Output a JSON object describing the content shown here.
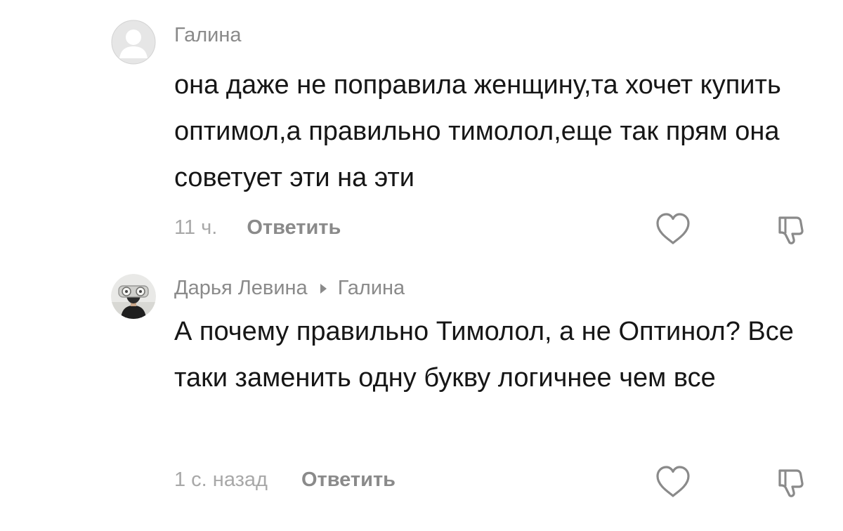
{
  "comments": [
    {
      "author": "Галина",
      "avatar_icon": "default-user-avatar",
      "text": "она даже не поправила женщину,та хочет купить оптимол,а правильно тимолол,еще так прям она советует эти на эти",
      "time": "11 ч.",
      "reply_label": "Ответить",
      "like_icon": "heart-outline-icon",
      "dislike_icon": "thumbs-down-icon"
    },
    {
      "author": "Дарья Левина",
      "reply_to": "Галина",
      "avatar_icon": "user-photo-avatar",
      "text": "А почему правильно Тимолол, а не Оптинол? Все таки заменить одну букву логичнее чем все",
      "time": "1 с. назад",
      "reply_label": "Ответить",
      "like_icon": "heart-outline-icon",
      "dislike_icon": "thumbs-down-icon"
    }
  ],
  "colors": {
    "text_primary": "#161616",
    "text_secondary": "#8a8a8a",
    "text_muted": "#a8a8a8",
    "avatar_placeholder": "#dcdcdc"
  }
}
